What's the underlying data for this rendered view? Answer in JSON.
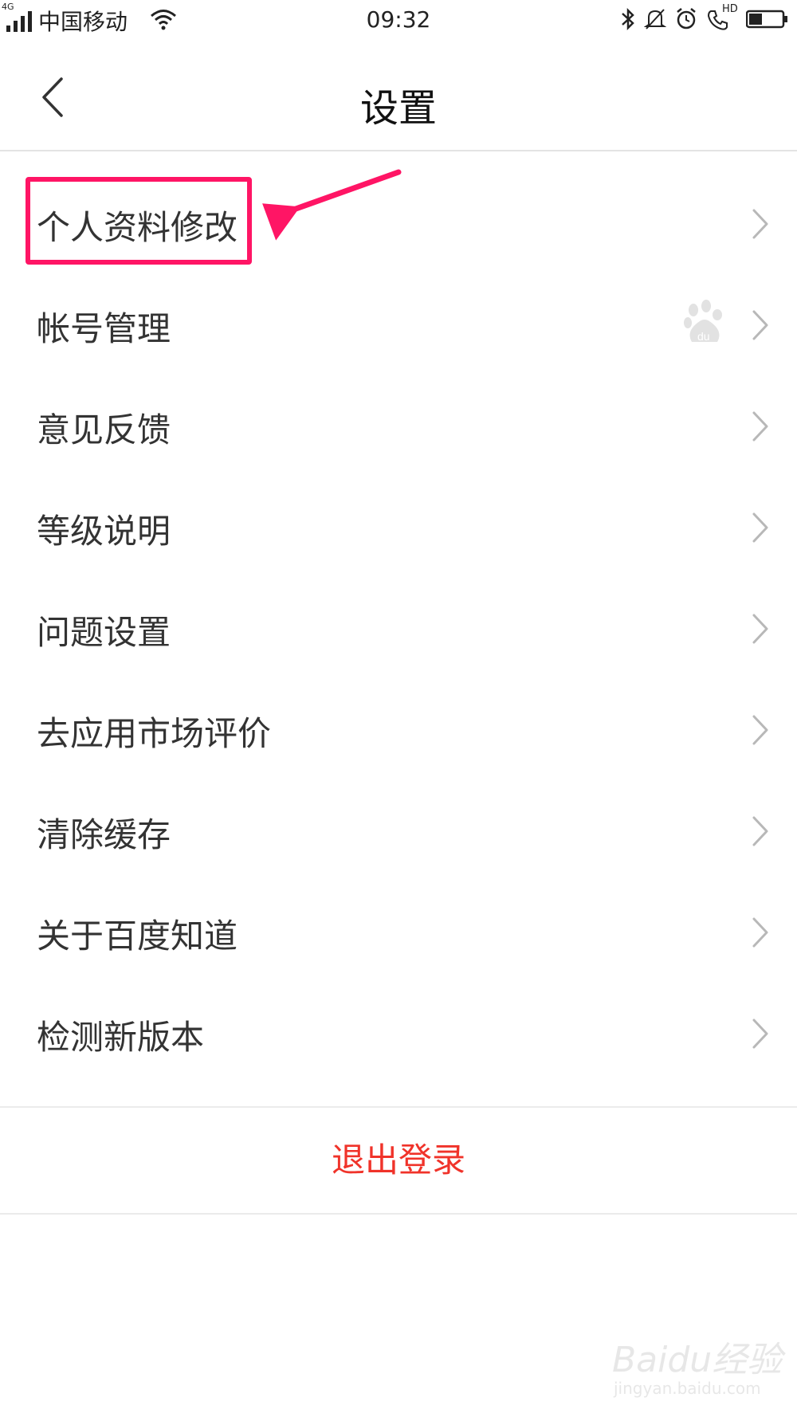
{
  "status_bar": {
    "network": "4G",
    "carrier": "中国移动",
    "time": "09:32",
    "call_hd": "HD",
    "icons": [
      "signal-icon",
      "wifi-icon",
      "bluetooth-icon",
      "mute-icon",
      "alarm-icon",
      "hd-call-icon",
      "battery-icon"
    ],
    "battery_level": 0.4
  },
  "nav": {
    "title": "设置",
    "back_icon": "chevron-left-icon"
  },
  "settings_items": [
    {
      "label": "个人资料修改"
    },
    {
      "label": "帐号管理",
      "badge_icon": "baidu-paw-icon"
    },
    {
      "label": "意见反馈"
    },
    {
      "label": "等级说明"
    },
    {
      "label": "问题设置"
    },
    {
      "label": "去应用市场评价"
    },
    {
      "label": "清除缓存"
    },
    {
      "label": "关于百度知道"
    },
    {
      "label": "检测新版本"
    }
  ],
  "logout_label": "退出登录",
  "annotation": {
    "color": "#ff1565"
  },
  "colors": {
    "logout": "#f0332a",
    "annotation": "#ff1565",
    "divider": "#e3e3e3"
  },
  "watermark": {
    "brand": "Baidu经验",
    "url": "jingyan.baidu.com"
  }
}
